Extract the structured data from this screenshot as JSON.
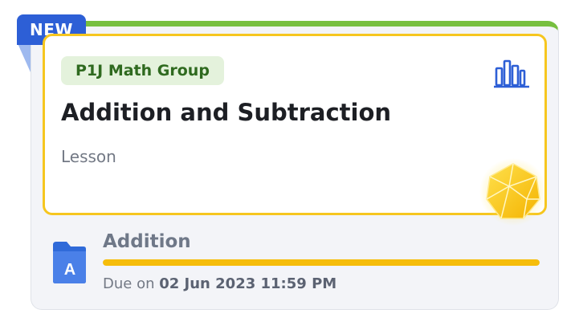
{
  "badge": {
    "new_label": "NEW"
  },
  "card": {
    "group": "P1J Math Group",
    "title": "Addition and Subtraction",
    "type": "Lesson",
    "chart_icon": "bar-chart-icon",
    "reward_icon": "gold-gem-icon"
  },
  "assignment": {
    "icon": "folder-a-icon",
    "icon_letter": "A",
    "title": "Addition",
    "progress_percent": 100,
    "due_prefix": "Due on",
    "due_date": "02 Jun 2023 11:59 PM"
  },
  "colors": {
    "accent_green": "#77bf3f",
    "accent_gold": "#f6c61f",
    "brand_blue": "#2d5fd6",
    "progress": "#f6bd0b"
  }
}
